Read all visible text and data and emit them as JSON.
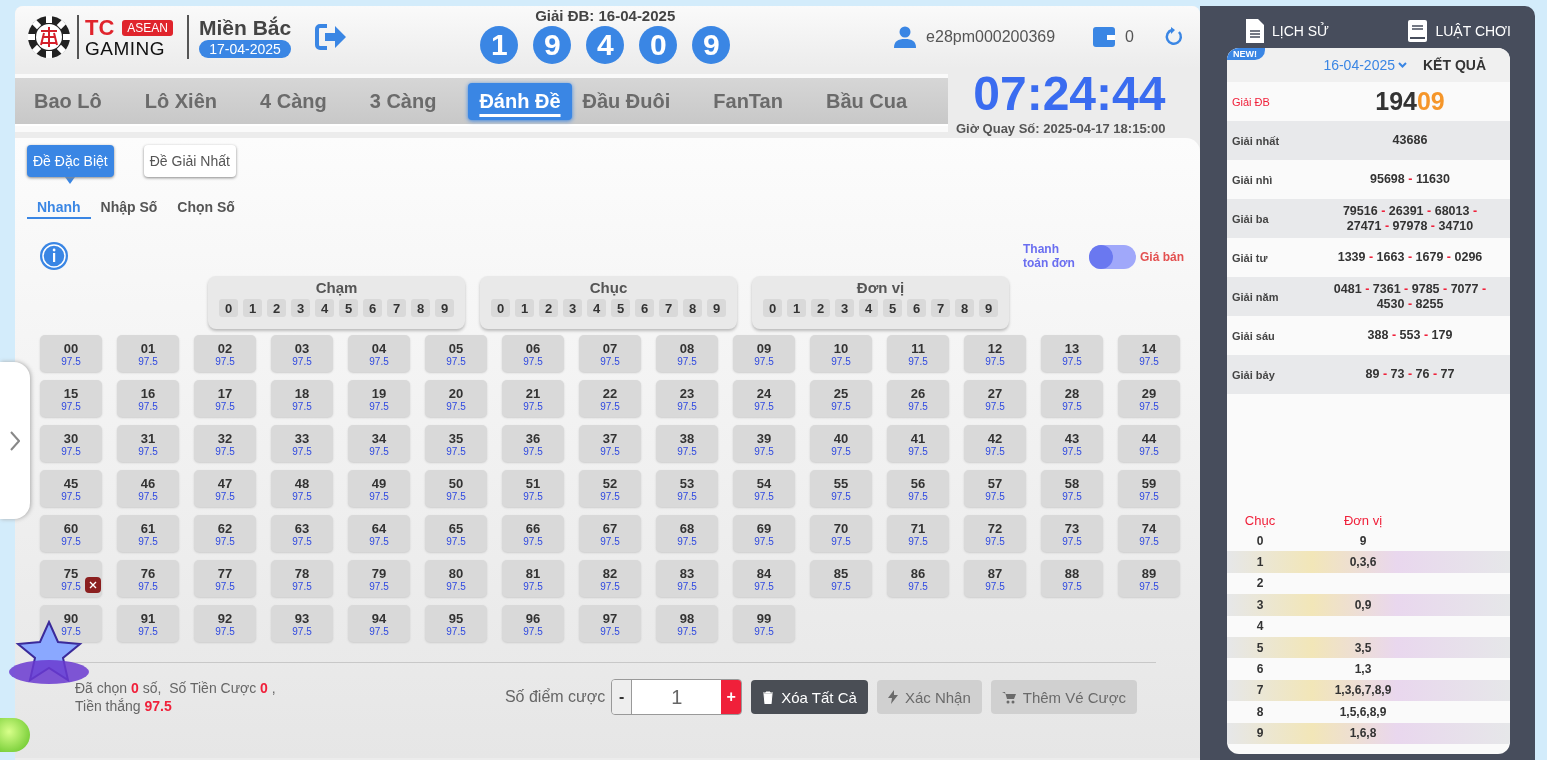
{
  "header": {
    "logo_brand": "TC",
    "logo_badge": "ASEAN",
    "logo_sub": "GAMING",
    "region": "Miền Bắc",
    "date": "17-04-2025",
    "last_draw_label": "Giải ĐB: 16-04-2025",
    "last_draw_digits": [
      "1",
      "9",
      "4",
      "0",
      "9"
    ],
    "username": "e28pm000200369",
    "balance": "0"
  },
  "game_tabs": [
    {
      "label": "Bao Lô",
      "selected": false
    },
    {
      "label": "Lô Xiên",
      "selected": false
    },
    {
      "label": "4 Càng",
      "selected": false
    },
    {
      "label": "3 Càng",
      "selected": false
    },
    {
      "label": "Đánh Đề",
      "selected": true
    },
    {
      "label": "Đầu Đuôi",
      "selected": false
    },
    {
      "label": "FanTan",
      "selected": false
    },
    {
      "label": "Bầu Cua",
      "selected": false
    }
  ],
  "countdown": {
    "time": "07:24:44",
    "draw_time": "Giờ Quay Số: 2025-04-17 18:15:00"
  },
  "bet_types": [
    {
      "label": "Đề Đặc Biệt",
      "selected": true
    },
    {
      "label": "Đề Giải Nhất",
      "selected": false
    }
  ],
  "input_modes": [
    {
      "label": "Nhanh",
      "selected": true
    },
    {
      "label": "Nhập Số",
      "selected": false
    },
    {
      "label": "Chọn Số",
      "selected": false
    }
  ],
  "toggle": {
    "left_label": "Thanh toán đơn",
    "right_label": "Giá bán",
    "on": false
  },
  "pickers": [
    {
      "title": "Chạm",
      "digits": [
        "0",
        "1",
        "2",
        "3",
        "4",
        "5",
        "6",
        "7",
        "8",
        "9"
      ]
    },
    {
      "title": "Chục",
      "digits": [
        "0",
        "1",
        "2",
        "3",
        "4",
        "5",
        "6",
        "7",
        "8",
        "9"
      ]
    },
    {
      "title": "Đơn vị",
      "digits": [
        "0",
        "1",
        "2",
        "3",
        "4",
        "5",
        "6",
        "7",
        "8",
        "9"
      ]
    }
  ],
  "numbers": [
    {
      "number": "00",
      "rate": "97.5",
      "marked": false
    },
    {
      "number": "01",
      "rate": "97.5",
      "marked": false
    },
    {
      "number": "02",
      "rate": "97.5",
      "marked": false
    },
    {
      "number": "03",
      "rate": "97.5",
      "marked": false
    },
    {
      "number": "04",
      "rate": "97.5",
      "marked": false
    },
    {
      "number": "05",
      "rate": "97.5",
      "marked": false
    },
    {
      "number": "06",
      "rate": "97.5",
      "marked": false
    },
    {
      "number": "07",
      "rate": "97.5",
      "marked": false
    },
    {
      "number": "08",
      "rate": "97.5",
      "marked": false
    },
    {
      "number": "09",
      "rate": "97.5",
      "marked": false
    },
    {
      "number": "10",
      "rate": "97.5",
      "marked": false
    },
    {
      "number": "11",
      "rate": "97.5",
      "marked": false
    },
    {
      "number": "12",
      "rate": "97.5",
      "marked": false
    },
    {
      "number": "13",
      "rate": "97.5",
      "marked": false
    },
    {
      "number": "14",
      "rate": "97.5",
      "marked": false
    },
    {
      "number": "15",
      "rate": "97.5",
      "marked": false
    },
    {
      "number": "16",
      "rate": "97.5",
      "marked": false
    },
    {
      "number": "17",
      "rate": "97.5",
      "marked": false
    },
    {
      "number": "18",
      "rate": "97.5",
      "marked": false
    },
    {
      "number": "19",
      "rate": "97.5",
      "marked": false
    },
    {
      "number": "20",
      "rate": "97.5",
      "marked": false
    },
    {
      "number": "21",
      "rate": "97.5",
      "marked": false
    },
    {
      "number": "22",
      "rate": "97.5",
      "marked": false
    },
    {
      "number": "23",
      "rate": "97.5",
      "marked": false
    },
    {
      "number": "24",
      "rate": "97.5",
      "marked": false
    },
    {
      "number": "25",
      "rate": "97.5",
      "marked": false
    },
    {
      "number": "26",
      "rate": "97.5",
      "marked": false
    },
    {
      "number": "27",
      "rate": "97.5",
      "marked": false
    },
    {
      "number": "28",
      "rate": "97.5",
      "marked": false
    },
    {
      "number": "29",
      "rate": "97.5",
      "marked": false
    },
    {
      "number": "30",
      "rate": "97.5",
      "marked": false
    },
    {
      "number": "31",
      "rate": "97.5",
      "marked": false
    },
    {
      "number": "32",
      "rate": "97.5",
      "marked": false
    },
    {
      "number": "33",
      "rate": "97.5",
      "marked": false
    },
    {
      "number": "34",
      "rate": "97.5",
      "marked": false
    },
    {
      "number": "35",
      "rate": "97.5",
      "marked": false
    },
    {
      "number": "36",
      "rate": "97.5",
      "marked": false
    },
    {
      "number": "37",
      "rate": "97.5",
      "marked": false
    },
    {
      "number": "38",
      "rate": "97.5",
      "marked": false
    },
    {
      "number": "39",
      "rate": "97.5",
      "marked": false
    },
    {
      "number": "40",
      "rate": "97.5",
      "marked": false
    },
    {
      "number": "41",
      "rate": "97.5",
      "marked": false
    },
    {
      "number": "42",
      "rate": "97.5",
      "marked": false
    },
    {
      "number": "43",
      "rate": "97.5",
      "marked": false
    },
    {
      "number": "44",
      "rate": "97.5",
      "marked": false
    },
    {
      "number": "45",
      "rate": "97.5",
      "marked": false
    },
    {
      "number": "46",
      "rate": "97.5",
      "marked": false
    },
    {
      "number": "47",
      "rate": "97.5",
      "marked": false
    },
    {
      "number": "48",
      "rate": "97.5",
      "marked": false
    },
    {
      "number": "49",
      "rate": "97.5",
      "marked": false
    },
    {
      "number": "50",
      "rate": "97.5",
      "marked": false
    },
    {
      "number": "51",
      "rate": "97.5",
      "marked": false
    },
    {
      "number": "52",
      "rate": "97.5",
      "marked": false
    },
    {
      "number": "53",
      "rate": "97.5",
      "marked": false
    },
    {
      "number": "54",
      "rate": "97.5",
      "marked": false
    },
    {
      "number": "55",
      "rate": "97.5",
      "marked": false
    },
    {
      "number": "56",
      "rate": "97.5",
      "marked": false
    },
    {
      "number": "57",
      "rate": "97.5",
      "marked": false
    },
    {
      "number": "58",
      "rate": "97.5",
      "marked": false
    },
    {
      "number": "59",
      "rate": "97.5",
      "marked": false
    },
    {
      "number": "60",
      "rate": "97.5",
      "marked": false
    },
    {
      "number": "61",
      "rate": "97.5",
      "marked": false
    },
    {
      "number": "62",
      "rate": "97.5",
      "marked": false
    },
    {
      "number": "63",
      "rate": "97.5",
      "marked": false
    },
    {
      "number": "64",
      "rate": "97.5",
      "marked": false
    },
    {
      "number": "65",
      "rate": "97.5",
      "marked": false
    },
    {
      "number": "66",
      "rate": "97.5",
      "marked": false
    },
    {
      "number": "67",
      "rate": "97.5",
      "marked": false
    },
    {
      "number": "68",
      "rate": "97.5",
      "marked": false
    },
    {
      "number": "69",
      "rate": "97.5",
      "marked": false
    },
    {
      "number": "70",
      "rate": "97.5",
      "marked": false
    },
    {
      "number": "71",
      "rate": "97.5",
      "marked": false
    },
    {
      "number": "72",
      "rate": "97.5",
      "marked": false
    },
    {
      "number": "73",
      "rate": "97.5",
      "marked": false
    },
    {
      "number": "74",
      "rate": "97.5",
      "marked": false
    },
    {
      "number": "75",
      "rate": "97.5",
      "marked": true
    },
    {
      "number": "76",
      "rate": "97.5",
      "marked": false
    },
    {
      "number": "77",
      "rate": "97.5",
      "marked": false
    },
    {
      "number": "78",
      "rate": "97.5",
      "marked": false
    },
    {
      "number": "79",
      "rate": "97.5",
      "marked": false
    },
    {
      "number": "80",
      "rate": "97.5",
      "marked": false
    },
    {
      "number": "81",
      "rate": "97.5",
      "marked": false
    },
    {
      "number": "82",
      "rate": "97.5",
      "marked": false
    },
    {
      "number": "83",
      "rate": "97.5",
      "marked": false
    },
    {
      "number": "84",
      "rate": "97.5",
      "marked": false
    },
    {
      "number": "85",
      "rate": "97.5",
      "marked": false
    },
    {
      "number": "86",
      "rate": "97.5",
      "marked": false
    },
    {
      "number": "87",
      "rate": "97.5",
      "marked": false
    },
    {
      "number": "88",
      "rate": "97.5",
      "marked": false
    },
    {
      "number": "89",
      "rate": "97.5",
      "marked": false
    },
    {
      "number": "90",
      "rate": "97.5",
      "marked": false
    },
    {
      "number": "91",
      "rate": "97.5",
      "marked": false
    },
    {
      "number": "92",
      "rate": "97.5",
      "marked": false
    },
    {
      "number": "93",
      "rate": "97.5",
      "marked": false
    },
    {
      "number": "94",
      "rate": "97.5",
      "marked": false
    },
    {
      "number": "95",
      "rate": "97.5",
      "marked": false
    },
    {
      "number": "96",
      "rate": "97.5",
      "marked": false
    },
    {
      "number": "97",
      "rate": "97.5",
      "marked": false
    },
    {
      "number": "98",
      "rate": "97.5",
      "marked": false
    },
    {
      "number": "99",
      "rate": "97.5",
      "marked": false
    }
  ],
  "summary": {
    "chosen_label": "Đã chọn",
    "chosen": "0",
    "chosen_unit": "số,",
    "stake_label": "Số Tiền Cược",
    "stake": "0",
    "stake_suffix": ",",
    "win_label": "Tiền thắng",
    "win": "97.5"
  },
  "stake_input": {
    "label": "Số điểm cược",
    "minus": "-",
    "value": "1",
    "plus": "+"
  },
  "actions": [
    {
      "label": "Xóa Tất Cả",
      "kind": "clear",
      "disabled": false
    },
    {
      "label": "Xác Nhận",
      "kind": "confirm",
      "disabled": true
    },
    {
      "label": "Thêm Vé Cược",
      "kind": "cart",
      "disabled": true
    }
  ],
  "side": {
    "links": [
      {
        "label": "LỊCH SỬ",
        "kind": "history"
      },
      {
        "label": "LUẬT CHƠI",
        "kind": "rules"
      }
    ],
    "badge": "NEW!",
    "date": "16-04-2025",
    "title": "KẾT QUẢ",
    "separator": "-",
    "prizes": [
      {
        "name": "Giải ĐB",
        "kind": "special",
        "head": "194",
        "tail": "09"
      },
      {
        "name": "Giải nhất",
        "kind": "normal",
        "numbers": [
          "43686"
        ]
      },
      {
        "name": "Giải nhì",
        "kind": "normal",
        "numbers": [
          "95698",
          "11630"
        ]
      },
      {
        "name": "Giải ba",
        "kind": "normal",
        "numbers": [
          "79516",
          "26391",
          "68013",
          "27471",
          "97978",
          "34710"
        ]
      },
      {
        "name": "Giải tư",
        "kind": "normal",
        "numbers": [
          "1339",
          "1663",
          "1679",
          "0296"
        ]
      },
      {
        "name": "Giải năm",
        "kind": "normal",
        "numbers": [
          "0481",
          "7361",
          "9785",
          "7077",
          "4530",
          "8255"
        ]
      },
      {
        "name": "Giải sáu",
        "kind": "normal",
        "numbers": [
          "388",
          "553",
          "179"
        ]
      },
      {
        "name": "Giải bảy",
        "kind": "normal",
        "numbers": [
          "89",
          "73",
          "76",
          "77"
        ]
      }
    ],
    "lo_table": {
      "columns": [
        "Chục",
        "Đơn vị"
      ],
      "rows": [
        {
          "head": "0",
          "tails": "9"
        },
        {
          "head": "1",
          "tails": "0,3,6"
        },
        {
          "head": "2"
        },
        {
          "head": "3",
          "tails": "0,9"
        },
        {
          "head": "4"
        },
        {
          "head": "5",
          "tails": "3,5"
        },
        {
          "head": "6",
          "tails": "1,3"
        },
        {
          "head": "7",
          "tails": "1,3,6,7,8,9"
        },
        {
          "head": "8",
          "tails": "1,5,6,8,9"
        },
        {
          "head": "9",
          "tails": "1,6,8"
        }
      ]
    }
  }
}
